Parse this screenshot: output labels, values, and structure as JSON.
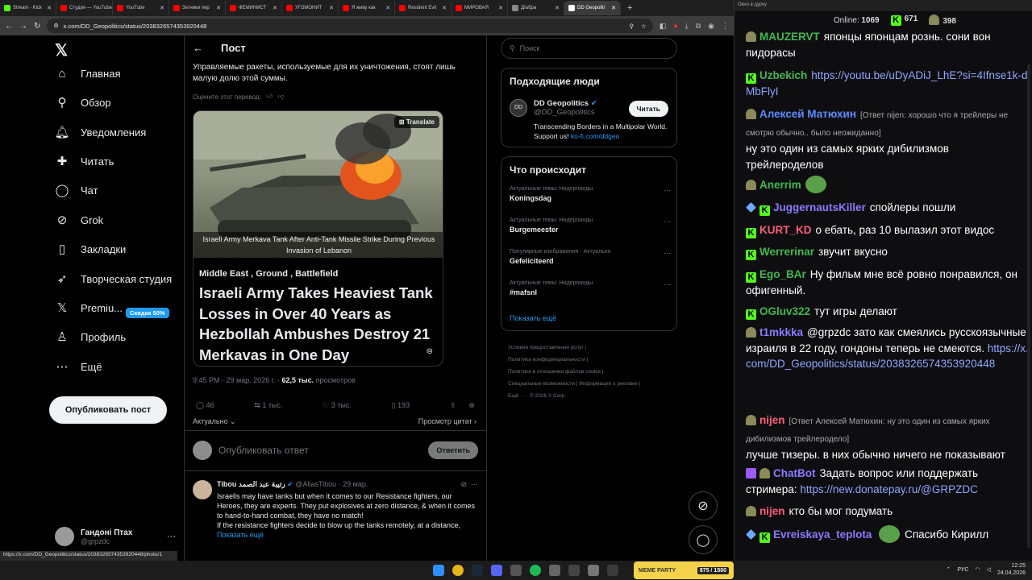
{
  "browser": {
    "tabs": [
      {
        "label": "Stream - Kick",
        "color": "#53fc18"
      },
      {
        "label": "Студия — YouTube",
        "color": "#ff0000"
      },
      {
        "label": "YouTube",
        "color": "#ff0000"
      },
      {
        "label": "Зетники пер",
        "color": "#ff0000"
      },
      {
        "label": "ФЕМИНИСТ",
        "color": "#ff0000"
      },
      {
        "label": "УГОМОНИТ",
        "color": "#ff0000"
      },
      {
        "label": "Я живу как",
        "color": "#ff0000"
      },
      {
        "label": "Resident Evil",
        "color": "#ff0000"
      },
      {
        "label": "МИРОВАЯ",
        "color": "#ff0000"
      },
      {
        "label": "Дїабра",
        "color": "#888888"
      },
      {
        "label": "DD Geopoliti",
        "color": "#ffffff",
        "active": true
      }
    ],
    "new_tab": "+",
    "url": "x.com/DD_Geopolitics/status/2038326574353920448",
    "status_url": "https://x.com/DD_Geopolitics/status/2038326574353920448/photo/1"
  },
  "nav": {
    "logo": "𝕏",
    "items": [
      {
        "label": "Главная",
        "icon": "⌂",
        "name": "home"
      },
      {
        "label": "Обзор",
        "icon": "⚲",
        "name": "explore"
      },
      {
        "label": "Уведомления",
        "icon": "🔔︎",
        "name": "notifications"
      },
      {
        "label": "Читать",
        "icon": "✚",
        "name": "follow"
      },
      {
        "label": "Чат",
        "icon": "◯",
        "name": "chat"
      },
      {
        "label": "Grok",
        "icon": "⊘",
        "name": "grok"
      },
      {
        "label": "Закладки",
        "icon": "▯",
        "name": "bookmarks"
      },
      {
        "label": "Творческая студия",
        "icon": "➶",
        "name": "studio"
      },
      {
        "label": "Premiu...",
        "icon": "𝕏",
        "name": "premium"
      },
      {
        "label": "Профиль",
        "icon": "♙",
        "name": "profile"
      },
      {
        "label": "Ещё",
        "icon": "⋯",
        "name": "more"
      }
    ],
    "premium_badge": "Скидка 50%",
    "post_button": "Опубликовать пост",
    "profile_name": "Гандоні Птах",
    "profile_handle": "@grpzdc"
  },
  "post": {
    "header": "Пост",
    "text": "Управляемые ракеты, используемые для их уничтожения, стоят лишь малую долю этой суммы.",
    "rate_translation": "Оцените этот перевод:",
    "translate_btn": "Translate",
    "image_caption": "Israeli Army Merkava Tank After Anti-Tank Missile Strike During Previous Invasion of Lebanon",
    "article_tags": "Middle East , Ground , Battlefield",
    "article_title": "Israeli Army Takes Heaviest Tank Losses in Over 40 Years as Hezbollah Ambushes Destroy 21 Merkavas in One Day",
    "meta_time": "9:45 PM · 29 мар. 2026 г. ·",
    "views": "62,5 тыс.",
    "views_label": "просмотров",
    "replies": "46",
    "reposts": "1 тыс.",
    "likes": "3 тыс.",
    "bookmarks": "193",
    "sort_label": "Актуально",
    "quotes_label": "Просмотр цитат",
    "reply_placeholder": "Опубликовать ответ",
    "reply_button": "Ответить"
  },
  "reply": {
    "name": "Tibou رتيبة عبد الصمد",
    "handle": "@AliasTibou · 29 мар.",
    "text": "Israelis may have tanks but when it comes to our Resistance fighters, our Heroes, they are experts. They put explosives at zero distance, & when it comes to hand-to-hand combat, they have no match!\nIf the resistance fighters decide to blow up the tanks remotely, at a distance,",
    "show_more": "Показать ещё"
  },
  "right": {
    "search_placeholder": "Поиск",
    "who_title": "Подходящие люди",
    "who_name": "DD Geopolitics",
    "who_handle": "@DD_Geopolitics",
    "who_bio": "Transcending Borders in a Multipolar World. Support us!",
    "who_link": "ko-fi.com/ddgeo",
    "follow_btn": "Читать",
    "trends_title": "Что происходит",
    "trends": [
      {
        "meta": "Актуальные темы: Нидерланды",
        "name": "Koningsdag"
      },
      {
        "meta": "Актуальные темы: Нидерланды",
        "name": "Burgemeester"
      },
      {
        "meta": "Популярные изображения · Актуально",
        "name": "Gefeliciteerd"
      },
      {
        "meta": "Актуальные темы: Нидерланды",
        "name": "#mafsnl"
      }
    ],
    "show_more": "Показать ещё",
    "footer1": "Условия предоставления услуг",
    "footer2": "Политика конфиденциальности",
    "footer3": "Политика в отношении файлов cookie",
    "footer4": "Специальные возможности",
    "footer5": "Информация о рекламе",
    "footer6": "Ещё ···",
    "footer7": "© 2026 X Corp."
  },
  "chat": {
    "window_title": "Окно в дурку",
    "online_label": "Online:",
    "online": "1069",
    "stat1": "671",
    "stat2": "398",
    "messages": [
      {
        "user": "MAUZERVT",
        "color": "#3fb950",
        "text": "японцы японцам рознь. сони вон пидорасы"
      },
      {
        "user": "Uzbekich",
        "color": "#3fb950",
        "text": "",
        "link": "https://youtu.be/uDyADiJ_LhE?si=4Ifnse1k-dMbFlyI"
      },
      {
        "user": "Алексей Матюхин",
        "color": "#5b8cff",
        "reply": "[Ответ nijen: хорошо что я трейлеры не смотрю обычно.. было неожиданно]",
        "text": "ну это один из самых ярких дибилизмов трейлероделов"
      },
      {
        "user": "Anerrim",
        "color": "#3fb950",
        "text": ""
      },
      {
        "user": "JuggernautsKiller",
        "color": "#8a7cff",
        "text": "спойлеры пошли"
      },
      {
        "user": "KURT_KD",
        "color": "#ff5c7a",
        "text": "о ебать, раз 10 вылазил этот видос"
      },
      {
        "user": "Werrerinar",
        "color": "#3fb950",
        "text": "звучит вкусно"
      },
      {
        "user": "Ego_BAr",
        "color": "#3fb950",
        "text": "Ну фильм мне всё ровно понравился, он офигенный."
      },
      {
        "user": "OGluv322",
        "color": "#3fb950",
        "text": "тут игры делают"
      },
      {
        "user": "t1mkkka",
        "color": "#8a7cff",
        "text": "@grpzdc зато как смеялись русскоязычные израиля   в 22 году, гондоны теперь не смеются.",
        "link": "https://x.com/DD_Geopolitics/status/2038326574353920448"
      },
      {
        "user": "nijen",
        "color": "#ff5c7a",
        "reply": "[Ответ Алексей Матюхин: ну это один из самых ярких дибилизмов трейлеродело]",
        "text": "лучше тизеры. в них обычно ничего не показывают"
      },
      {
        "user": "ChatBot",
        "color": "#8a7cff",
        "text": "Задать вопрос или поддержать стримера:",
        "link": "https://new.donatepay.ru/@GRPZDC"
      },
      {
        "user": "nijen",
        "color": "#ff5c7a",
        "text": "кто бы мог подумать"
      },
      {
        "user": "Evreiskaya_teplota",
        "color": "#8a7cff",
        "text": "Спасибо Кирилл"
      }
    ]
  },
  "taskbar": {
    "meme_party": "MEME PARTY",
    "meme_progress": "875 / 1500",
    "lang": "РУС",
    "time": "12:25",
    "date": "24.04.2026"
  }
}
